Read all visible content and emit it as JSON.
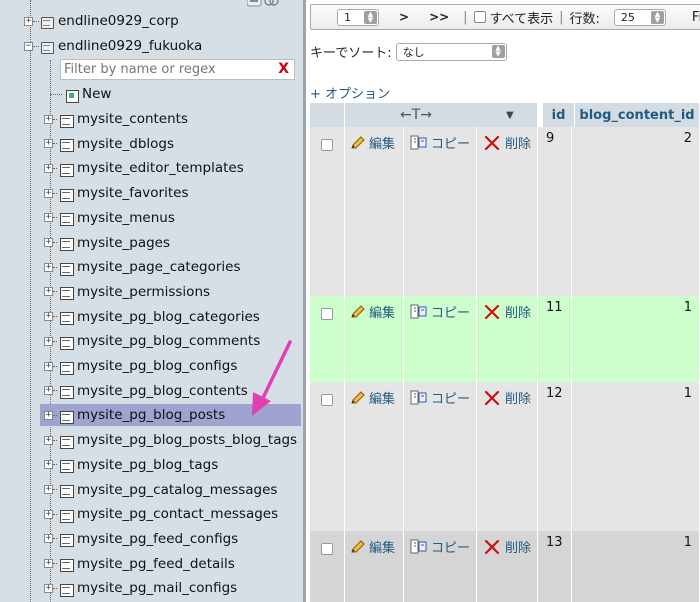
{
  "nav": {
    "databases": [
      {
        "name": "endline0929_corp"
      },
      {
        "name": "endline0929_fukuoka"
      }
    ],
    "filter_placeholder": "Filter by name or regex",
    "filter_clear": "X",
    "new_label": "New",
    "tables": [
      "mysite_contents",
      "mysite_dblogs",
      "mysite_editor_templates",
      "mysite_favorites",
      "mysite_menus",
      "mysite_pages",
      "mysite_page_categories",
      "mysite_permissions",
      "mysite_pg_blog_categories",
      "mysite_pg_blog_comments",
      "mysite_pg_blog_configs",
      "mysite_pg_blog_contents",
      "mysite_pg_blog_posts",
      "mysite_pg_blog_posts_blog_tags",
      "mysite_pg_blog_tags",
      "mysite_pg_catalog_messages",
      "mysite_pg_contact_messages",
      "mysite_pg_feed_configs",
      "mysite_pg_feed_details",
      "mysite_pg_mail_configs"
    ],
    "selected_table": "mysite_pg_blog_posts"
  },
  "toolbar": {
    "page_value": "1",
    "next": ">",
    "last": ">>",
    "sep": "|",
    "show_all": "すべて表示",
    "rows_label": "行数:",
    "rows_value": "25",
    "filter_cut": "Fil"
  },
  "sort": {
    "label": "キーでソート:",
    "value": "なし"
  },
  "options_link": "+ オプション",
  "grid": {
    "headers": {
      "arrows": "←T→",
      "id": "id",
      "blog_content_id": "blog_content_id"
    },
    "action_labels": {
      "edit": "編集",
      "copy": "コピー",
      "delete": "削除"
    },
    "rows": [
      {
        "id": "9",
        "blog_content_id": "2"
      },
      {
        "id": "11",
        "blog_content_id": "1"
      },
      {
        "id": "12",
        "blog_content_id": "1"
      },
      {
        "id": "13",
        "blog_content_id": "1"
      }
    ]
  },
  "colors": {
    "nav_bg": "#d6dfe5",
    "selected_row": "#9ea3cf",
    "header_bg": "#d3dce3",
    "link": "#235a81",
    "highlight_row": "#ccffcc",
    "arrow": "#e040b0"
  }
}
